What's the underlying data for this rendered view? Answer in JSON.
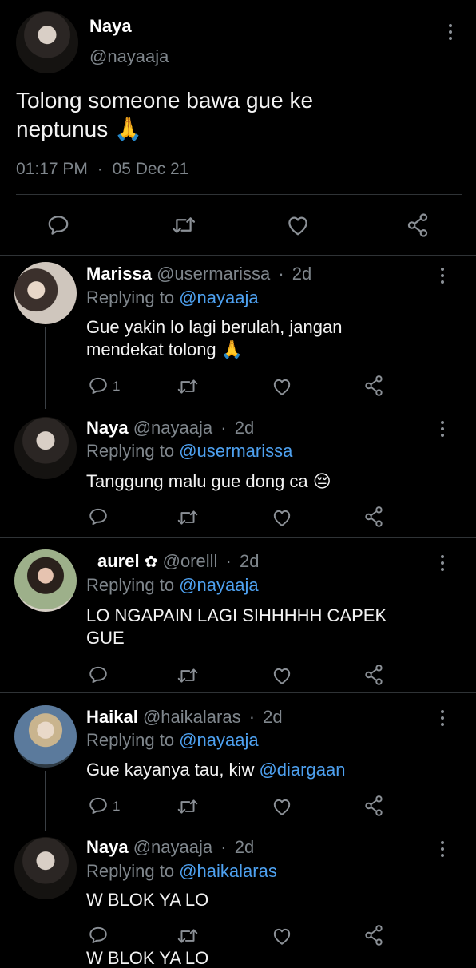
{
  "main_tweet": {
    "name": "Naya",
    "handle": "@nayaaja",
    "text_line1": "Tolong someone bawa gue ke",
    "text_line2": "neptunus",
    "emoji": "🙏",
    "time": "01:17 PM",
    "separator": "·",
    "date": "05 Dec 21"
  },
  "replying_prefix": "Replying to",
  "replies": [
    {
      "name": "Marissa",
      "handle": "@usermarissa",
      "dot": "·",
      "age": "2d",
      "replying_to": "@nayaaja",
      "line1": "Gue yakin lo lagi berulah, jangan",
      "line2": "mendekat tolong",
      "emoji": "🙏",
      "reply_count": "1"
    },
    {
      "name": "Naya",
      "handle": "@nayaaja",
      "dot": "·",
      "age": "2d",
      "replying_to": "@usermarissa",
      "line1": "Tanggung malu gue dong ca",
      "emoji": "😔"
    },
    {
      "name": "aurel",
      "badge": "✿",
      "handle": "@orelll",
      "dot": "·",
      "age": "2d",
      "replying_to": "@nayaaja",
      "line1": "LO NGAPAIN LAGI SIHHHHH CAPEK",
      "line2": "GUE"
    },
    {
      "name": "Haikal",
      "handle": "@haikalaras",
      "dot": "·",
      "age": "2d",
      "replying_to": "@nayaaja",
      "line1_prefix": "Gue kayanya tau, kiw",
      "mention": "@diargaan",
      "reply_count": "1"
    },
    {
      "name": "Naya",
      "handle": "@nayaaja",
      "dot": "·",
      "age": "2d",
      "replying_to": "@haikalaras",
      "line1": "W BLOK YA LO"
    }
  ],
  "next_preview": "W BLOK YA LO",
  "colors": {
    "background": "#000000",
    "link": "#4ea1f0",
    "muted": "#7f868c",
    "divider": "#2f3336"
  },
  "icons": [
    "reply-icon",
    "retweet-icon",
    "like-icon",
    "share-icon",
    "more-icon"
  ]
}
